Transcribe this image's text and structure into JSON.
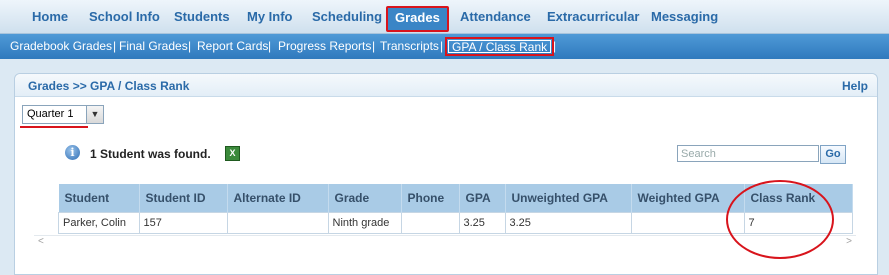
{
  "topnav": {
    "items": [
      "Home",
      "School Info",
      "Students",
      "My Info",
      "Scheduling",
      "Grades",
      "Attendance",
      "Extracurricular",
      "Messaging"
    ],
    "active": "Grades"
  },
  "subnav": {
    "items": [
      "Gradebook Grades",
      "Final Grades",
      "Report Cards",
      "Progress Reports",
      "Transcripts",
      "GPA / Class Rank"
    ],
    "active": "GPA / Class Rank"
  },
  "panel": {
    "breadcrumb": "Grades >> GPA / Class Rank",
    "help": "Help"
  },
  "filter": {
    "quarter": "Quarter 1"
  },
  "results": {
    "message": "1 Student was found."
  },
  "search": {
    "placeholder": "Search",
    "go": "Go"
  },
  "table": {
    "headers": [
      "Student",
      "Student ID",
      "Alternate ID",
      "Grade",
      "Phone",
      "GPA",
      "Unweighted GPA",
      "Weighted GPA",
      "Class Rank"
    ],
    "rows": [
      [
        "Parker, Colin",
        "157",
        "",
        "Ninth grade",
        "",
        "3.25",
        "3.25",
        "",
        "7"
      ]
    ]
  }
}
